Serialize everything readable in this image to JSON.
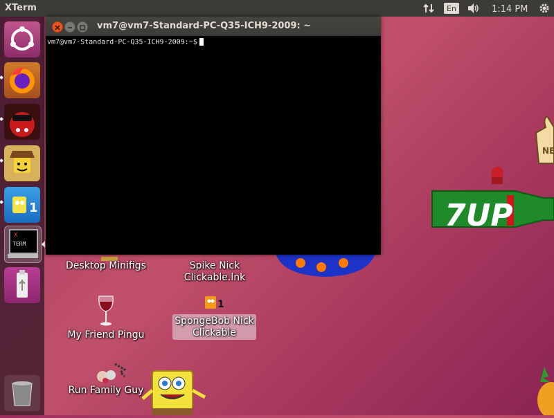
{
  "top_panel": {
    "app_name": "XTerm",
    "language": "En",
    "clock": "1:14 PM"
  },
  "terminal": {
    "title": "vm7@vm7-Standard-PC-Q35-ICH9-2009: ~",
    "prompt": "vm7@vm7-Standard-PC-Q35-ICH9-2009:~$"
  },
  "launcher": {
    "xterm_icon_text_1": "X",
    "xterm_icon_text_2": "TERM"
  },
  "desktop": {
    "icons": [
      {
        "label": "Desktop Minifigs"
      },
      {
        "label_line1": "Spike Nick",
        "label_line2": "Clickable.lnk"
      },
      {
        "label": "My Friend Pingu"
      },
      {
        "label_line1": "SpongeBob Nick",
        "label_line2": "Clickable"
      },
      {
        "label": "Run Family Guy"
      }
    ],
    "bottle_text": "7UP",
    "sign_text": "NE"
  },
  "colors": {
    "panel": "#3c3b37",
    "close_button": "#e95420",
    "wallpaper": "#b8456a"
  }
}
